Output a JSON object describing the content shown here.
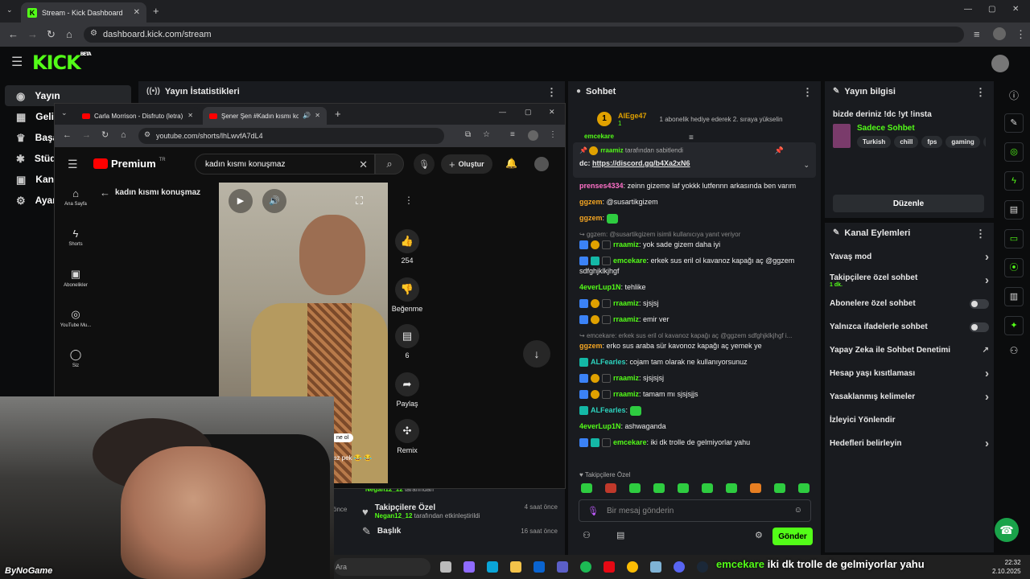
{
  "browser": {
    "tab_title": "Stream - Kick Dashboard",
    "url": "dashboard.kick.com/stream"
  },
  "kick": {
    "logo": "KICK",
    "logo_badge": "BETA"
  },
  "sidebar": {
    "items": [
      {
        "label": "Yayın",
        "icon": "broadcast-icon"
      },
      {
        "label": "Gelir",
        "icon": "money-icon"
      },
      {
        "label": "Başarı",
        "icon": "trophy-icon"
      },
      {
        "label": "Stüdyo",
        "icon": "studio-icon"
      },
      {
        "label": "Kanal",
        "icon": "channel-icon"
      },
      {
        "label": "Ayarla",
        "icon": "gear-icon"
      }
    ]
  },
  "stats_panel": {
    "title": "Yayın İstatistikleri"
  },
  "popup": {
    "tabs": [
      {
        "title": "Carla Morrison - Disfruto (letra)"
      },
      {
        "title": "Şener Şen #Kadın kısmı kon"
      }
    ],
    "url": "youtube.com/shorts/lhLwvfA7dL4",
    "yt": {
      "brand": "Premium",
      "brand_sup": "TR",
      "search_value": "kadın kısmı konuşmaz",
      "create_label": "Oluştur",
      "back_title": "kadın kısmı konuşmaz",
      "nav": [
        {
          "label": "Ana Sayfa",
          "icon": "home-icon"
        },
        {
          "label": "Shorts",
          "icon": "shorts-icon"
        },
        {
          "label": "Abonelikler",
          "icon": "subscriptions-icon"
        },
        {
          "label": "YouTube Mu...",
          "icon": "music-icon"
        },
        {
          "label": "Siz",
          "icon": "user-icon"
        }
      ],
      "actions": [
        {
          "label": "254",
          "icon": "like-icon"
        },
        {
          "label": "Beğenme",
          "icon": "dislike-icon"
        },
        {
          "label": "6",
          "icon": "comment-icon"
        },
        {
          "label": "Paylaş",
          "icon": "share-icon"
        },
        {
          "label": "Remix",
          "icon": "remix-icon"
        }
      ],
      "caption_chip": "ne ol",
      "caption_text": "az pek 😂 😂"
    }
  },
  "activity": [
    {
      "user": "Negan12_12",
      "suffix": "tarafından",
      "title": "",
      "time": ""
    },
    {
      "title": "Takipçilere Özel",
      "user": "Negan12_12",
      "suffix": "tarafından etkinleştirildi",
      "time": "4 saat önce"
    },
    {
      "title": "Başlık",
      "user": "",
      "suffix": "",
      "time": "16 saat önce"
    }
  ],
  "activity_left_time": "önce",
  "chat": {
    "title": "Sohbet",
    "top_user": "AlEge47",
    "top_user_sub": "1",
    "top_gift_text": "1 abonelik hediye ederek 2. sıraya yükselin",
    "pinned_by_user": "rraamiz",
    "pinned_by_suffix": "tarafından sabitlendi",
    "pinned_prefix": "dc:",
    "pinned_link": "https://discord.gg/b4Xa2xN6",
    "partial_user": "emcekare",
    "messages": [
      {
        "user": "prenses4334",
        "color": "#ff70c8",
        "text": "zeinn gizeme laf yokkk lutfennn arkasında ben varım",
        "badges": []
      },
      {
        "user": "ggzem",
        "color": "#f5a623",
        "text": "@susartikgizem",
        "badges": []
      },
      {
        "user": "ggzem",
        "color": "#f5a623",
        "text": "",
        "emote": true,
        "badges": []
      },
      {
        "reply": "ggzem: @susartikgizem isimli kullanıcıya yanıt veriyor"
      },
      {
        "user": "rraamiz",
        "color": "#53fc18",
        "text": "yok sade gizem daha iyi",
        "badges": [
          "mod",
          "sub",
          "x"
        ]
      },
      {
        "user": "emcekare",
        "color": "#53fc18",
        "text": "erkek sus eril ol kavanoz kapağı aç @ggzem sdfghjklkjhgf",
        "badges": [
          "mod",
          "bot",
          "x"
        ]
      },
      {
        "user": "4everLup1N",
        "color": "#53fc18",
        "text": "tehlike",
        "badges": []
      },
      {
        "user": "rraamiz",
        "color": "#53fc18",
        "text": "sjsjsj",
        "badges": [
          "mod",
          "sub",
          "x"
        ]
      },
      {
        "user": "rraamiz",
        "color": "#53fc18",
        "text": "emir ver",
        "badges": [
          "mod",
          "sub",
          "x"
        ]
      },
      {
        "reply": "emcekare: erkek sus eril ol kavanoz kapağı aç @ggzem sdfghjklkjhgf i..."
      },
      {
        "user": "ggzem",
        "color": "#f5a623",
        "text": "erko sus araba sür kavonoz kapağı aç yemek ye",
        "badges": []
      },
      {
        "user": "ALFearles",
        "color": "#2dd4bf",
        "text": "cojam tam olarak ne kullanıyorsunuz",
        "badges": [
          "bot"
        ]
      },
      {
        "user": "rraamiz",
        "color": "#53fc18",
        "text": "sjsjsjsj",
        "badges": [
          "mod",
          "sub",
          "x"
        ]
      },
      {
        "user": "rraamiz",
        "color": "#53fc18",
        "text": "tamam mı sjsjsjjs",
        "badges": [
          "mod",
          "sub",
          "x"
        ]
      },
      {
        "user": "ALFearles",
        "color": "#2dd4bf",
        "text": "",
        "emote": true,
        "badges": [
          "bot"
        ]
      },
      {
        "user": "4everLup1N",
        "color": "#53fc18",
        "text": "ashwaganda",
        "badges": []
      },
      {
        "user": "emcekare",
        "color": "#53fc18",
        "text": "iki dk trolle de gelmiyorlar yahu",
        "badges": [
          "mod",
          "bot",
          "x"
        ]
      }
    ],
    "followers_label": "Takipçilere Özel",
    "input_placeholder": "Bir mesaj gönderin",
    "send_label": "Gönder"
  },
  "info": {
    "title": "Yayın bilgisi",
    "stream_title": "bizde deriniz !dc !yt !insta",
    "category": "Sadece Sohbet",
    "tags": [
      "Turkish",
      "chill",
      "fps",
      "gaming",
      "fu"
    ],
    "edit_label": "Düzenle"
  },
  "channel_actions": {
    "title": "Kanal Eylemleri",
    "items": [
      {
        "label": "Yavaş mod",
        "control": "chevron"
      },
      {
        "label": "Takipçilere özel sohbet",
        "sub": "1 dk.",
        "control": "chevron"
      },
      {
        "label": "Abonelere özel sohbet",
        "control": "toggle"
      },
      {
        "label": "Yalnızca ifadelerle sohbet",
        "control": "toggle"
      },
      {
        "label": "Yapay Zeka ile Sohbet Denetimi",
        "control": "external"
      },
      {
        "label": "Hesap yaşı kısıtlaması",
        "control": "chevron"
      },
      {
        "label": "Yasaklanmış kelimeler",
        "control": "chevron"
      },
      {
        "label": "İzleyici Yönlendir",
        "control": "none"
      },
      {
        "label": "Hedefleri belirleyin",
        "control": "chevron"
      }
    ]
  },
  "taskbar": {
    "search_placeholder": "Ara",
    "time": "22:32",
    "date": "2.10.2025"
  },
  "overlay": {
    "watermark": "ByNoGame",
    "ticker_user": "emcekare",
    "ticker_text": "iki dk trolle de gelmiyorlar yahu"
  },
  "colors": {
    "kick_green": "#53fc18",
    "panel": "#191b1f"
  }
}
